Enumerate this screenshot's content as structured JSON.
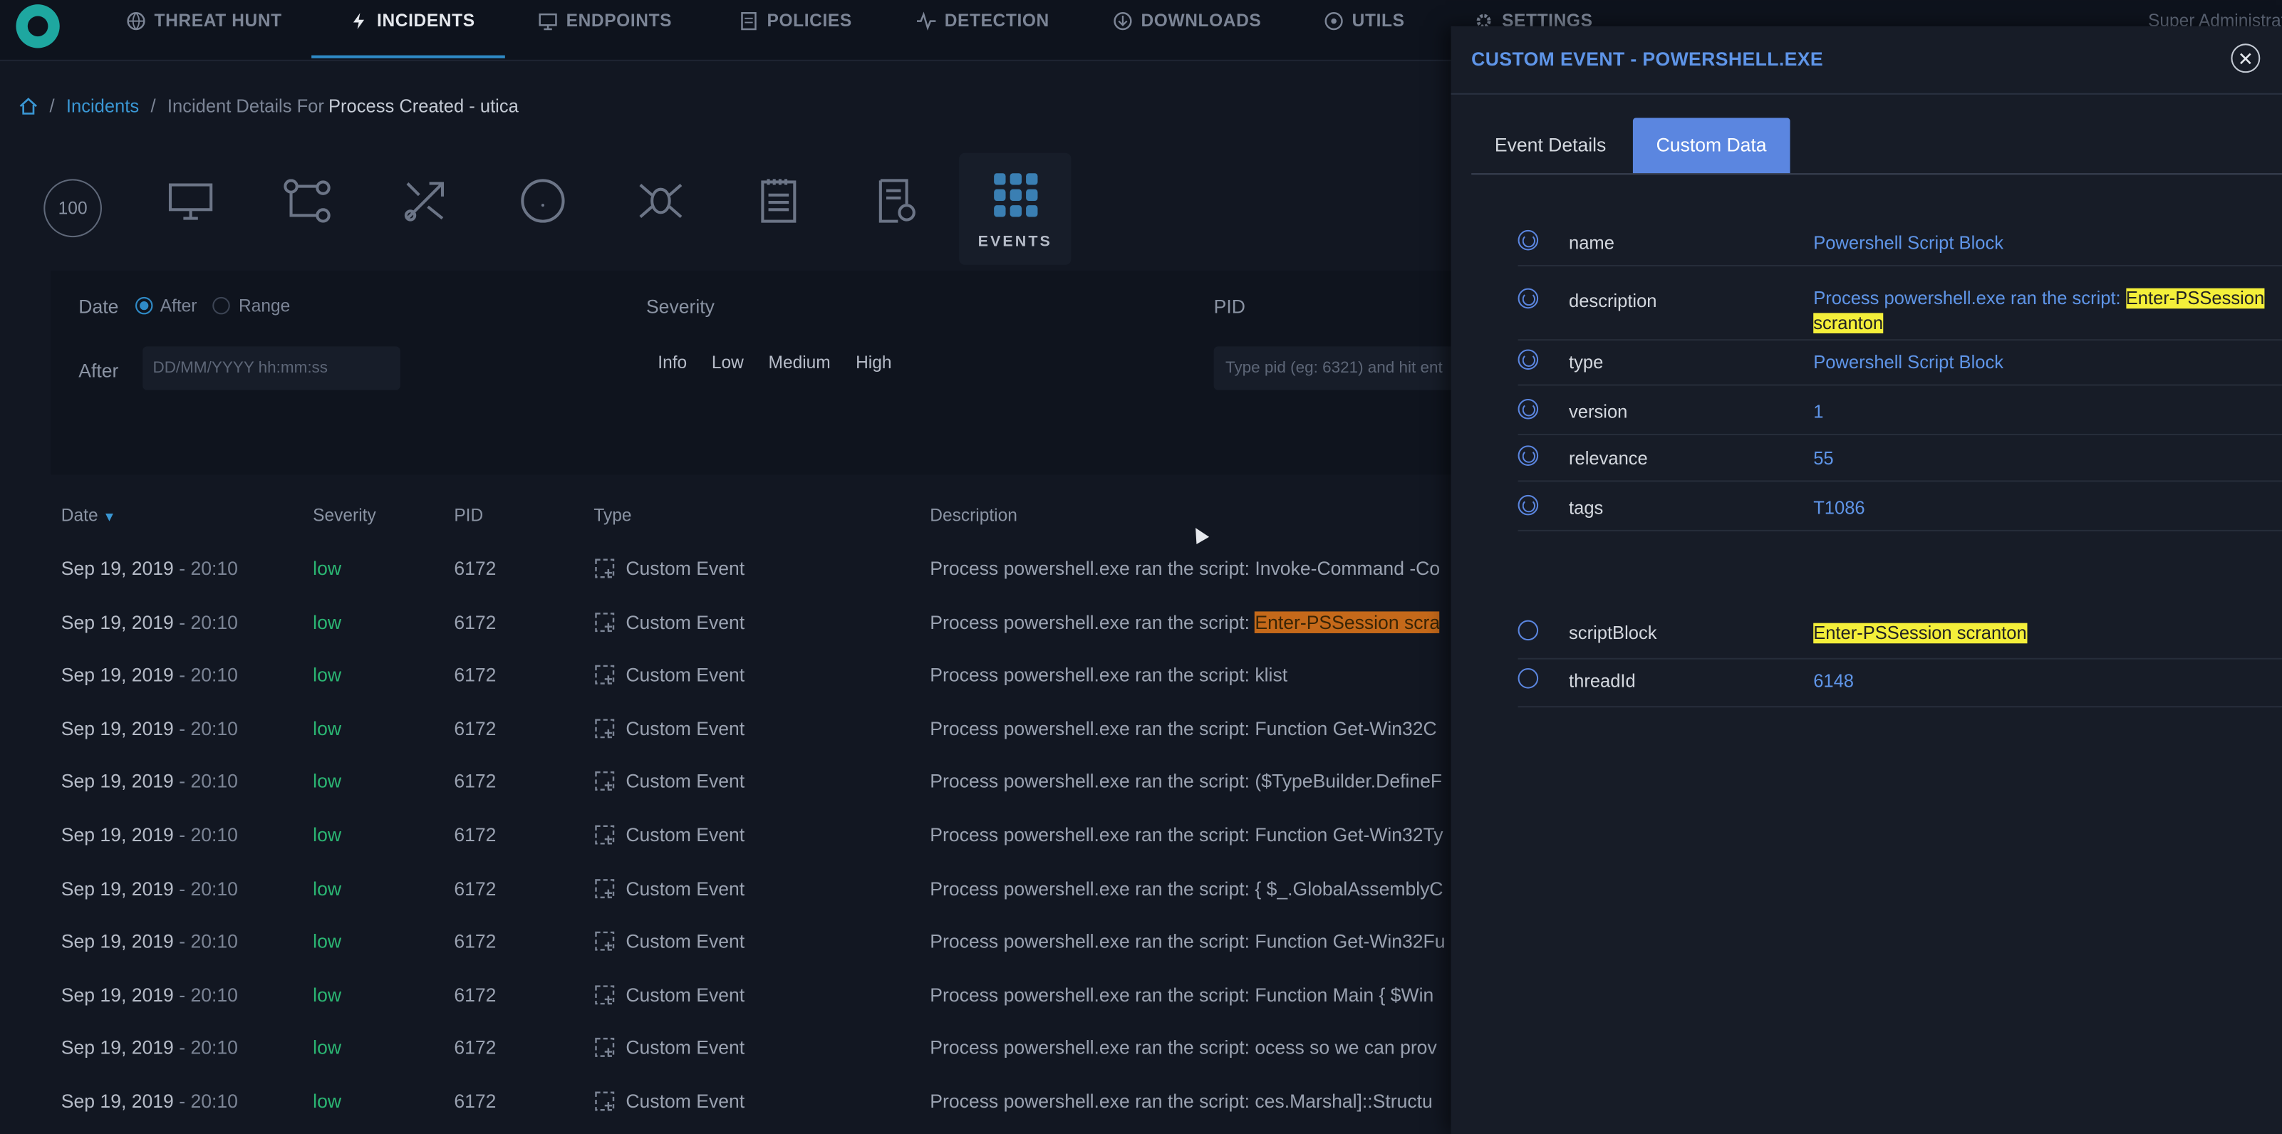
{
  "nav": {
    "items": [
      {
        "label": "THREAT HUNT",
        "icon": "globe-icon"
      },
      {
        "label": "INCIDENTS",
        "icon": "lightning-icon"
      },
      {
        "label": "ENDPOINTS",
        "icon": "monitor-icon"
      },
      {
        "label": "POLICIES",
        "icon": "document-icon"
      },
      {
        "label": "DETECTION",
        "icon": "pulse-icon"
      },
      {
        "label": "DOWNLOADS",
        "icon": "download-icon"
      },
      {
        "label": "UTILS",
        "icon": "tool-icon"
      },
      {
        "label": "SETTINGS",
        "icon": "gear-icon"
      }
    ],
    "user": "Super Administrat"
  },
  "breadcrumb": {
    "incidents": "Incidents",
    "prefix": "Incident Details For",
    "current": "Process Created - utica"
  },
  "toolbar": {
    "score": "100",
    "events_label": "EVENTS"
  },
  "filters": {
    "date_label": "Date",
    "after_option": "After",
    "range_option": "Range",
    "after_label": "After",
    "date_placeholder": "DD/MM/YYYY hh:mm:ss",
    "severity_label": "Severity",
    "severity_options": [
      "Info",
      "Low",
      "Medium",
      "High"
    ],
    "pid_label": "PID",
    "pid_placeholder": "Type pid (eg: 6321) and hit ent"
  },
  "table": {
    "headers": {
      "date": "Date",
      "severity": "Severity",
      "pid": "PID",
      "type": "Type",
      "description": "Description"
    },
    "desc_prefix": "Process powershell.exe ran the script:",
    "rows": [
      {
        "date": "Sep 19, 2019",
        "time": "- 20:10",
        "severity": "low",
        "pid": "6172",
        "type": "Custom Event",
        "desc": "Invoke-Command -Co"
      },
      {
        "date": "Sep 19, 2019",
        "time": "- 20:10",
        "severity": "low",
        "pid": "6172",
        "type": "Custom Event",
        "desc": "Enter-PSSession scra"
      },
      {
        "date": "Sep 19, 2019",
        "time": "- 20:10",
        "severity": "low",
        "pid": "6172",
        "type": "Custom Event",
        "desc": "klist"
      },
      {
        "date": "Sep 19, 2019",
        "time": "- 20:10",
        "severity": "low",
        "pid": "6172",
        "type": "Custom Event",
        "desc": "Function Get-Win32C"
      },
      {
        "date": "Sep 19, 2019",
        "time": "- 20:10",
        "severity": "low",
        "pid": "6172",
        "type": "Custom Event",
        "desc": "($TypeBuilder.DefineF"
      },
      {
        "date": "Sep 19, 2019",
        "time": "- 20:10",
        "severity": "low",
        "pid": "6172",
        "type": "Custom Event",
        "desc": "Function Get-Win32Ty"
      },
      {
        "date": "Sep 19, 2019",
        "time": "- 20:10",
        "severity": "low",
        "pid": "6172",
        "type": "Custom Event",
        "desc": "{ $_.GlobalAssemblyC"
      },
      {
        "date": "Sep 19, 2019",
        "time": "- 20:10",
        "severity": "low",
        "pid": "6172",
        "type": "Custom Event",
        "desc": "Function Get-Win32Fu"
      },
      {
        "date": "Sep 19, 2019",
        "time": "- 20:10",
        "severity": "low",
        "pid": "6172",
        "type": "Custom Event",
        "desc": "Function Main { $Win"
      },
      {
        "date": "Sep 19, 2019",
        "time": "- 20:10",
        "severity": "low",
        "pid": "6172",
        "type": "Custom Event",
        "desc": "ocess so we can prov"
      },
      {
        "date": "Sep 19, 2019",
        "time": "- 20:10",
        "severity": "low",
        "pid": "6172",
        "type": "Custom Event",
        "desc": "ces.Marshal]::Structu"
      }
    ]
  },
  "drawer": {
    "title": "CUSTOM EVENT - POWERSHELL.EXE",
    "tabs": [
      "Event Details",
      "Custom Data"
    ],
    "fields": [
      {
        "key": "name",
        "value": "Powershell Script Block"
      },
      {
        "key": "description",
        "value_prefix": "Process powershell.exe ran the script:",
        "value_highlight": "Enter-PSSession scranton"
      },
      {
        "key": "type",
        "value": "Powershell Script Block"
      },
      {
        "key": "version",
        "value": "1"
      },
      {
        "key": "relevance",
        "value": "55"
      },
      {
        "key": "tags",
        "value": "T1086"
      }
    ],
    "extra_fields": [
      {
        "key": "scriptBlock",
        "value": "Enter-PSSession scranton"
      },
      {
        "key": "threadId",
        "value": "6148"
      }
    ]
  },
  "colors": {
    "accent": "#2f8ac6",
    "drawer_accent": "#5b86e0",
    "severity_low": "#2bb673",
    "highlight": "#f4ef3a"
  }
}
